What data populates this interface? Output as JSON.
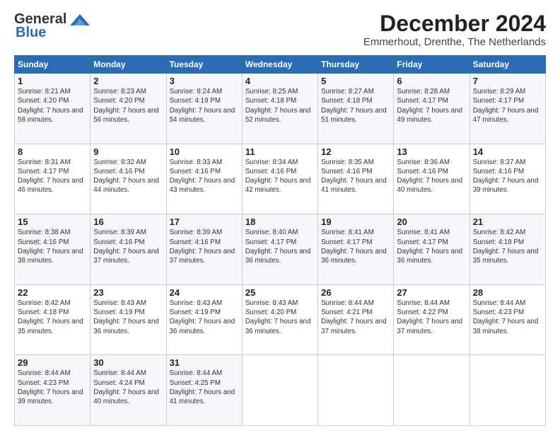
{
  "header": {
    "logo": {
      "general": "General",
      "blue": "Blue"
    },
    "title": "December 2024",
    "location": "Emmerhout, Drenthe, The Netherlands"
  },
  "calendar": {
    "days_of_week": [
      "Sunday",
      "Monday",
      "Tuesday",
      "Wednesday",
      "Thursday",
      "Friday",
      "Saturday"
    ],
    "weeks": [
      [
        {
          "day": "1",
          "sunrise": "8:21 AM",
          "sunset": "4:20 PM",
          "daylight": "7 hours and 58 minutes."
        },
        {
          "day": "2",
          "sunrise": "8:23 AM",
          "sunset": "4:20 PM",
          "daylight": "7 hours and 56 minutes."
        },
        {
          "day": "3",
          "sunrise": "8:24 AM",
          "sunset": "4:19 PM",
          "daylight": "7 hours and 54 minutes."
        },
        {
          "day": "4",
          "sunrise": "8:25 AM",
          "sunset": "4:18 PM",
          "daylight": "7 hours and 52 minutes."
        },
        {
          "day": "5",
          "sunrise": "8:27 AM",
          "sunset": "4:18 PM",
          "daylight": "7 hours and 51 minutes."
        },
        {
          "day": "6",
          "sunrise": "8:28 AM",
          "sunset": "4:17 PM",
          "daylight": "7 hours and 49 minutes."
        },
        {
          "day": "7",
          "sunrise": "8:29 AM",
          "sunset": "4:17 PM",
          "daylight": "7 hours and 47 minutes."
        }
      ],
      [
        {
          "day": "8",
          "sunrise": "8:31 AM",
          "sunset": "4:17 PM",
          "daylight": "7 hours and 46 minutes."
        },
        {
          "day": "9",
          "sunrise": "8:32 AM",
          "sunset": "4:16 PM",
          "daylight": "7 hours and 44 minutes."
        },
        {
          "day": "10",
          "sunrise": "8:33 AM",
          "sunset": "4:16 PM",
          "daylight": "7 hours and 43 minutes."
        },
        {
          "day": "11",
          "sunrise": "8:34 AM",
          "sunset": "4:16 PM",
          "daylight": "7 hours and 42 minutes."
        },
        {
          "day": "12",
          "sunrise": "8:35 AM",
          "sunset": "4:16 PM",
          "daylight": "7 hours and 41 minutes."
        },
        {
          "day": "13",
          "sunrise": "8:36 AM",
          "sunset": "4:16 PM",
          "daylight": "7 hours and 40 minutes."
        },
        {
          "day": "14",
          "sunrise": "8:37 AM",
          "sunset": "4:16 PM",
          "daylight": "7 hours and 39 minutes."
        }
      ],
      [
        {
          "day": "15",
          "sunrise": "8:38 AM",
          "sunset": "4:16 PM",
          "daylight": "7 hours and 38 minutes."
        },
        {
          "day": "16",
          "sunrise": "8:39 AM",
          "sunset": "4:16 PM",
          "daylight": "7 hours and 37 minutes."
        },
        {
          "day": "17",
          "sunrise": "8:39 AM",
          "sunset": "4:16 PM",
          "daylight": "7 hours and 37 minutes."
        },
        {
          "day": "18",
          "sunrise": "8:40 AM",
          "sunset": "4:17 PM",
          "daylight": "7 hours and 36 minutes."
        },
        {
          "day": "19",
          "sunrise": "8:41 AM",
          "sunset": "4:17 PM",
          "daylight": "7 hours and 36 minutes."
        },
        {
          "day": "20",
          "sunrise": "8:41 AM",
          "sunset": "4:17 PM",
          "daylight": "7 hours and 36 minutes."
        },
        {
          "day": "21",
          "sunrise": "8:42 AM",
          "sunset": "4:18 PM",
          "daylight": "7 hours and 35 minutes."
        }
      ],
      [
        {
          "day": "22",
          "sunrise": "8:42 AM",
          "sunset": "4:18 PM",
          "daylight": "7 hours and 35 minutes."
        },
        {
          "day": "23",
          "sunrise": "8:43 AM",
          "sunset": "4:19 PM",
          "daylight": "7 hours and 36 minutes."
        },
        {
          "day": "24",
          "sunrise": "8:43 AM",
          "sunset": "4:19 PM",
          "daylight": "7 hours and 36 minutes."
        },
        {
          "day": "25",
          "sunrise": "8:43 AM",
          "sunset": "4:20 PM",
          "daylight": "7 hours and 36 minutes."
        },
        {
          "day": "26",
          "sunrise": "8:44 AM",
          "sunset": "4:21 PM",
          "daylight": "7 hours and 37 minutes."
        },
        {
          "day": "27",
          "sunrise": "8:44 AM",
          "sunset": "4:22 PM",
          "daylight": "7 hours and 37 minutes."
        },
        {
          "day": "28",
          "sunrise": "8:44 AM",
          "sunset": "4:23 PM",
          "daylight": "7 hours and 38 minutes."
        }
      ],
      [
        {
          "day": "29",
          "sunrise": "8:44 AM",
          "sunset": "4:23 PM",
          "daylight": "7 hours and 39 minutes."
        },
        {
          "day": "30",
          "sunrise": "8:44 AM",
          "sunset": "4:24 PM",
          "daylight": "7 hours and 40 minutes."
        },
        {
          "day": "31",
          "sunrise": "8:44 AM",
          "sunset": "4:25 PM",
          "daylight": "7 hours and 41 minutes."
        },
        null,
        null,
        null,
        null
      ]
    ]
  }
}
